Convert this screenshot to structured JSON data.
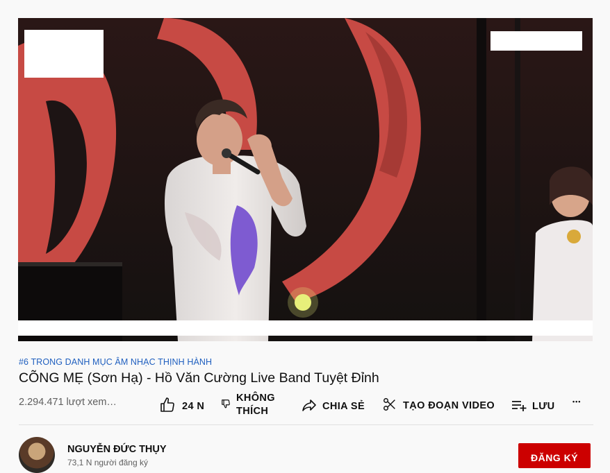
{
  "hashtag": "#6 TRONG DANH MỤC ÂM NHẠC THỊNH HÀNH",
  "title": "CÕNG MẸ (Sơn Hạ) - Hồ Văn Cường Live Band Tuyệt Đỉnh",
  "views": "2.294.471 lượt xem…",
  "actions": {
    "like": "24 N",
    "dislike_line1": "KHÔNG",
    "dislike_line2": "THÍCH",
    "share": "CHIA SẺ",
    "clip": "TẠO ĐOẠN VIDEO",
    "save": "LƯU",
    "more": "•••"
  },
  "channel": {
    "name": "NGUYỄN ĐỨC THỤY",
    "subscribers": "73,1 N người đăng ký"
  },
  "subscribe_label": "ĐĂNG KÝ",
  "icons": [
    "thumbs-up-icon",
    "thumbs-down-icon",
    "share-icon",
    "scissors-icon",
    "playlist-add-icon",
    "more-icon"
  ],
  "colors": {
    "link": "#1f5fbf",
    "subscribe": "#cc0000",
    "muted": "#606060"
  }
}
